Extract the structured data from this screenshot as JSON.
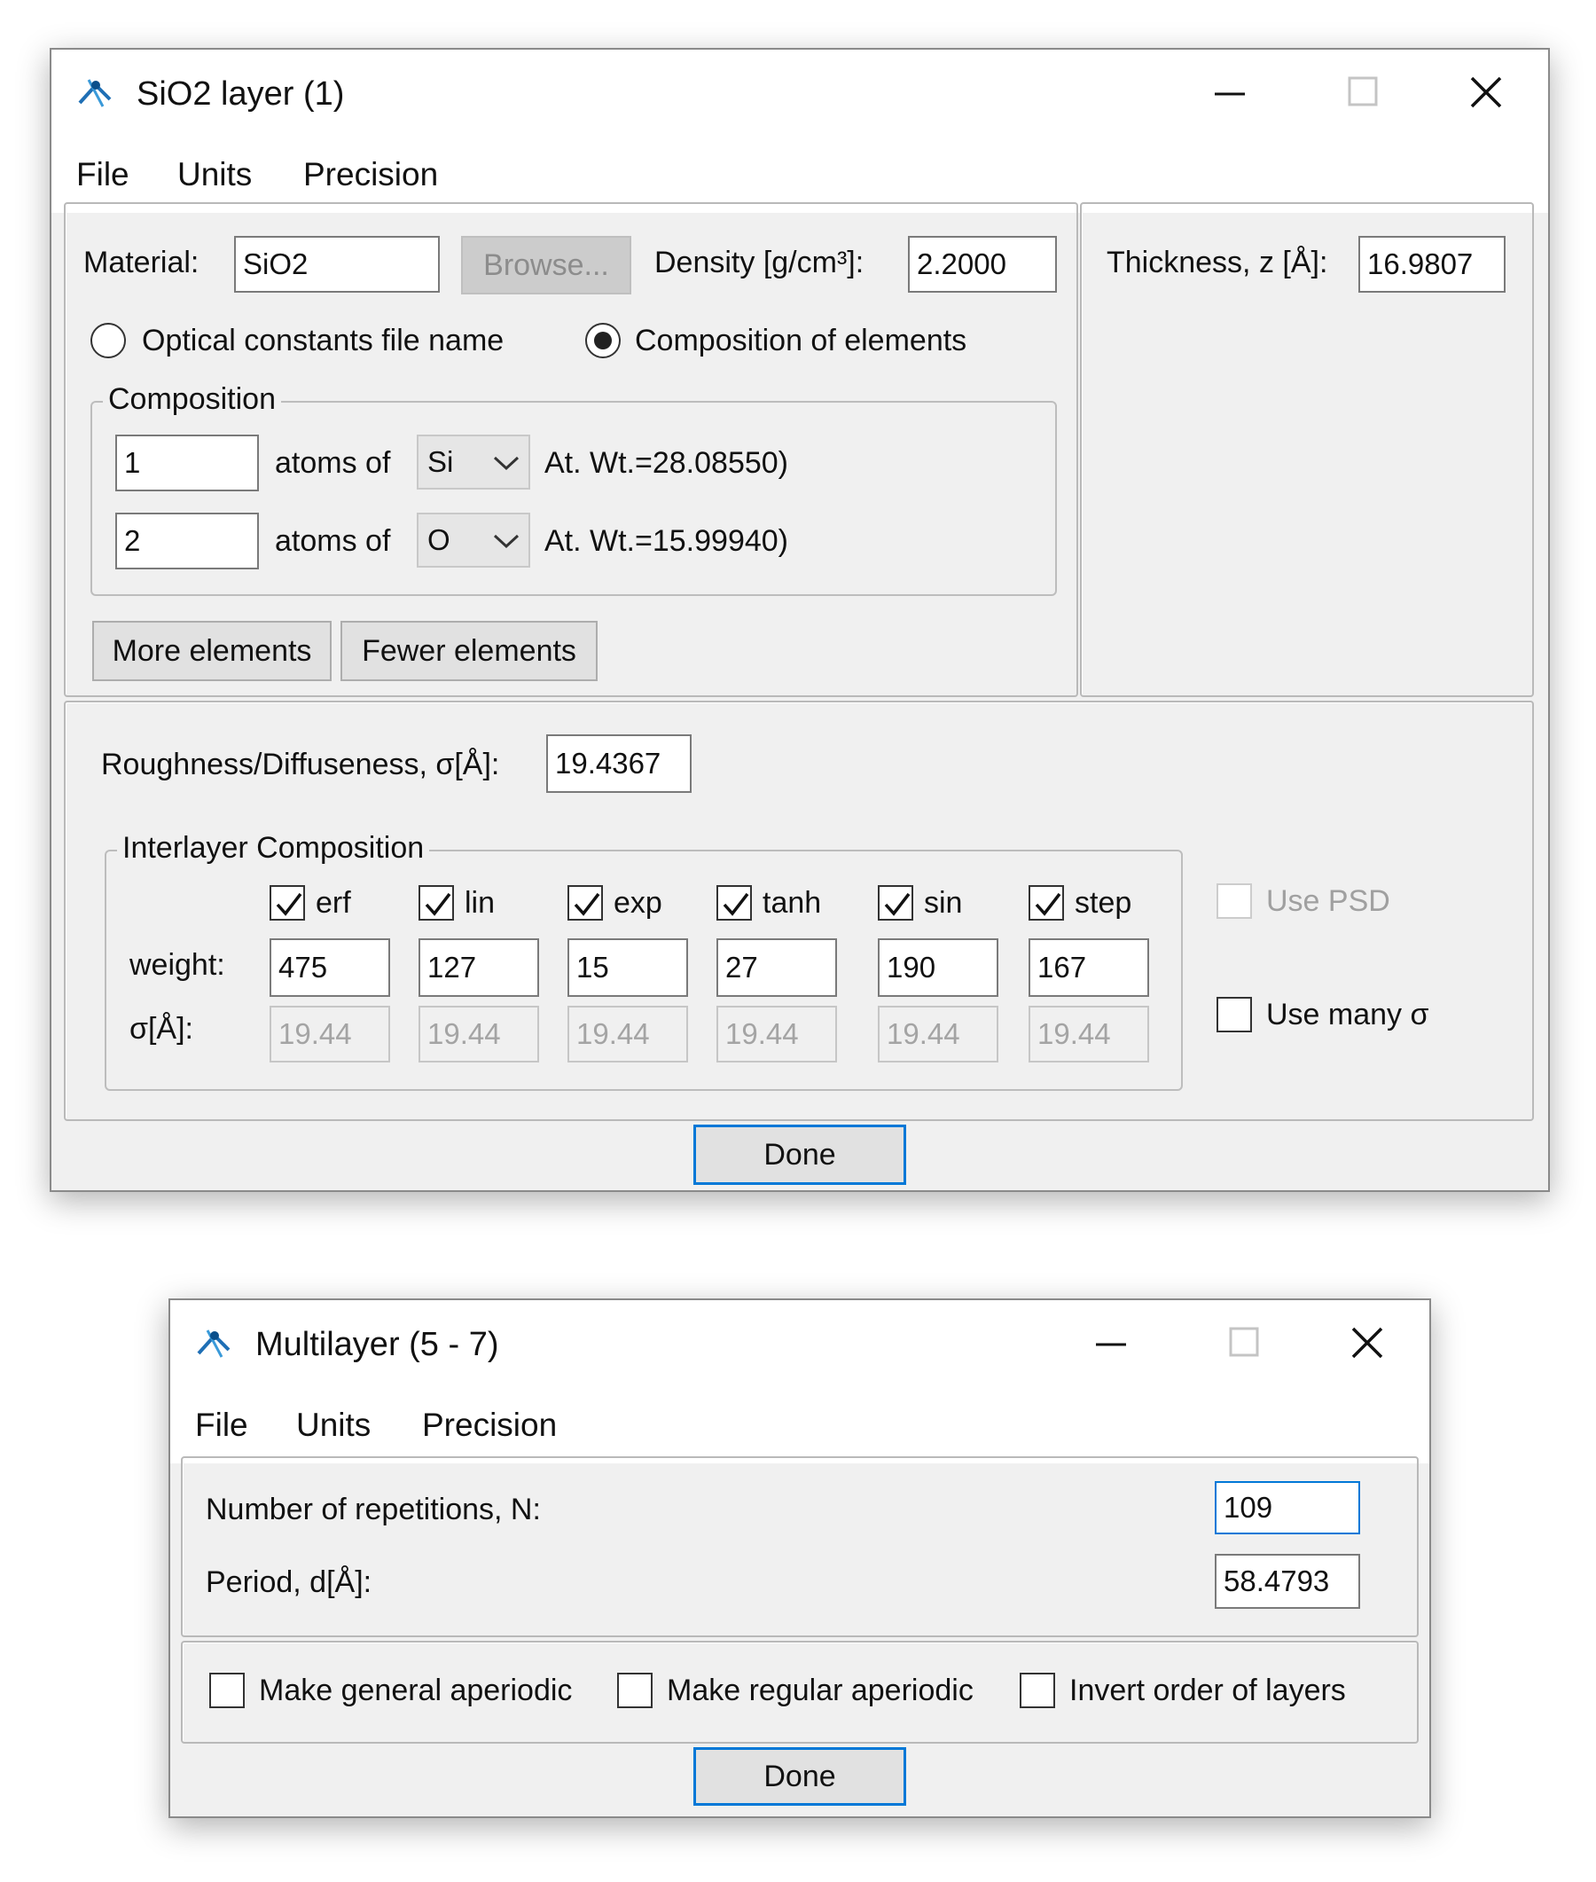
{
  "window1": {
    "title": "SiO2 layer (1)",
    "menu": [
      "File",
      "Units",
      "Precision"
    ],
    "material_label": "Material:",
    "material_value": "SiO2",
    "browse_label": "Browse...",
    "density_label": "Density [g/cm³]:",
    "density_value": "2.2000",
    "thickness_label": "Thickness, z [Å]:",
    "thickness_value": "16.9807",
    "radio_optical": "Optical constants file name",
    "radio_composition": "Composition of elements",
    "composition_title": "Composition",
    "composition": [
      {
        "count": "1",
        "atoms_of": "atoms of",
        "element": "Si",
        "at_wt": "At. Wt.=28.08550)"
      },
      {
        "count": "2",
        "atoms_of": "atoms of",
        "element": "O",
        "at_wt": "At. Wt.=15.99940)"
      }
    ],
    "more_elements": "More elements",
    "fewer_elements": "Fewer elements",
    "roughness_label": "Roughness/Diffuseness, σ[Å]:",
    "roughness_value": "19.4367",
    "interlayer_title": "Interlayer Composition",
    "weight_label": "weight:",
    "sigma_label": "σ[Å]:",
    "interlayer": [
      {
        "name": "erf",
        "weight": "475",
        "sigma": "19.44"
      },
      {
        "name": "lin",
        "weight": "127",
        "sigma": "19.44"
      },
      {
        "name": "exp",
        "weight": "15",
        "sigma": "19.44"
      },
      {
        "name": "tanh",
        "weight": "27",
        "sigma": "19.44"
      },
      {
        "name": "sin",
        "weight": "190",
        "sigma": "19.44"
      },
      {
        "name": "step",
        "weight": "167",
        "sigma": "19.44"
      }
    ],
    "use_psd": "Use PSD",
    "use_many_sigma": "Use many σ",
    "done": "Done"
  },
  "window2": {
    "title": "Multilayer (5 - 7)",
    "menu": [
      "File",
      "Units",
      "Precision"
    ],
    "repetitions_label": "Number of repetitions, N:",
    "repetitions_value": "109",
    "period_label": "Period, d[Å]:",
    "period_value": "58.4793",
    "make_general_aperiodic": "Make general aperiodic",
    "make_regular_aperiodic": "Make regular aperiodic",
    "invert_order": "Invert order of layers",
    "done": "Done"
  },
  "icons": {
    "app": "app-icon",
    "minimize": "minimize-icon",
    "maximize": "maximize-icon",
    "close": "close-icon",
    "dropdown": "chevron-down-icon",
    "check": "check-icon"
  }
}
